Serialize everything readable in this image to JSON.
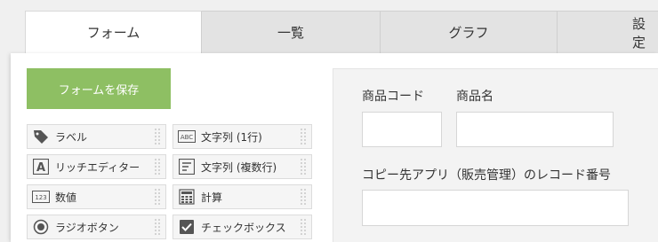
{
  "tabs": [
    {
      "label": "フォーム",
      "active": true
    },
    {
      "label": "一覧",
      "active": false
    },
    {
      "label": "グラフ",
      "active": false
    },
    {
      "label": "設定",
      "active": false
    }
  ],
  "save_button": {
    "label": "フォームを保存",
    "color": "#8ebf63"
  },
  "palette": {
    "items": [
      {
        "label": "ラベル",
        "icon": "tag-icon"
      },
      {
        "label": "文字列 (1行)",
        "icon": "text-abc-icon"
      },
      {
        "label": "リッチエディター",
        "icon": "rich-editor-icon"
      },
      {
        "label": "文字列 (複数行)",
        "icon": "multiline-text-icon"
      },
      {
        "label": "数値",
        "icon": "number-icon"
      },
      {
        "label": "計算",
        "icon": "calculator-icon"
      },
      {
        "label": "ラジオボタン",
        "icon": "radio-button-icon"
      },
      {
        "label": "チェックボックス",
        "icon": "checkbox-icon"
      }
    ]
  },
  "form_canvas": {
    "fields": [
      {
        "label": "商品コード"
      },
      {
        "label": "商品名"
      },
      {
        "label": "コピー先アプリ（販売管理）のレコード番号"
      }
    ]
  }
}
